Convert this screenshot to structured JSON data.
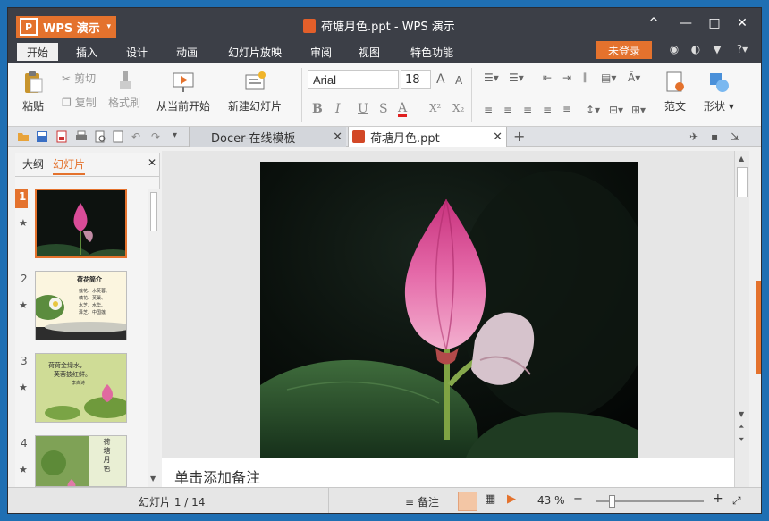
{
  "app": {
    "name": "WPS 演示",
    "logo": "P",
    "doc_title": "荷塘月色.ppt - WPS 演示"
  },
  "window_controls": {
    "help": "^",
    "minimize": "—",
    "maximize": "□",
    "close": "✕"
  },
  "menu": {
    "tabs": [
      "开始",
      "插入",
      "设计",
      "动画",
      "幻灯片放映",
      "审阅",
      "视图",
      "特色功能"
    ],
    "active": "开始",
    "login": "未登录",
    "help": "?"
  },
  "ribbon": {
    "paste": "粘贴",
    "cut": "剪切",
    "copy": "复制",
    "format_painter": "格式刷",
    "play_from_current": "从当前开始",
    "new_slide": "新建幻灯片",
    "font": "Arial",
    "font_size": "18",
    "bold": "B",
    "italic": "I",
    "underline": "U",
    "strike": "S",
    "font_color": "A",
    "superscript": "X²",
    "subscript": "X₂",
    "template": "范文",
    "shapes": "形状"
  },
  "doc_tabs": [
    {
      "label": "Docer-在线模板"
    },
    {
      "label": "荷塘月色.ppt"
    }
  ],
  "pane": {
    "tabs": [
      "大纲",
      "幻灯片"
    ],
    "active": "幻灯片"
  },
  "thumbnails": [
    {
      "num": "1",
      "selected": true,
      "title": "",
      "lines": []
    },
    {
      "num": "2",
      "selected": false,
      "title": "荷花简介",
      "lines": [
        "莲花、水芙蓉、",
        "藕花、芙蕖、",
        "水芝、水华、",
        "泽芝、中国莲"
      ]
    },
    {
      "num": "3",
      "selected": false,
      "title": "荷荷金绿水，",
      "lines": [
        "芙蓉披红鲜。",
        "李白诗"
      ]
    },
    {
      "num": "4",
      "selected": false,
      "title": "荷塘月色",
      "lines": []
    }
  ],
  "notes_placeholder": "单击添加备注",
  "status": {
    "slide_counter": "幻灯片 1 / 14",
    "notes": "备注",
    "zoom": "43 %",
    "zoom_level": 0.43
  },
  "colors": {
    "accent": "#e4722d",
    "titlebar": "#3c3f47",
    "lotus": "#d94c98"
  }
}
